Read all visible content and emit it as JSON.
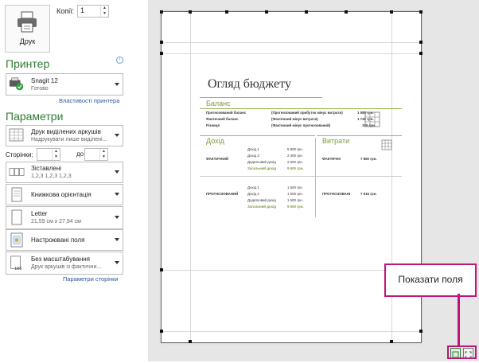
{
  "print": {
    "label": "Друк"
  },
  "copies": {
    "label": "Копії:",
    "value": "1"
  },
  "printer": {
    "section_title": "Принтер",
    "name": "Snagit 12",
    "status": "Готово",
    "properties_link": "Властивості принтера"
  },
  "parameters": {
    "section_title": "Параметри",
    "scope": {
      "title": "Друк виділених аркушів",
      "subtitle": "Надрукувати лише виділені..."
    },
    "pages": {
      "label": "Сторінки:",
      "to": "до"
    },
    "collate": {
      "title": "Зіставлені",
      "subtitle": "1,2,3    1,2,3    1,2,3"
    },
    "orientation": {
      "title": "Книжкова орієнтація"
    },
    "paper": {
      "title": "Letter",
      "subtitle": "21,59 см x 27,94 см"
    },
    "margins": {
      "title": "Настроювані поля"
    },
    "scaling": {
      "title": "Без масштабування",
      "subtitle": "Друк аркушів із фактични..."
    },
    "page_setup_link": "Параметри сторінки"
  },
  "preview": {
    "doc_title": "Огляд бюджету",
    "balance": {
      "heading": "Баланс",
      "rows": [
        {
          "label": "Прогнозований баланс",
          "desc": "(Прогнозований прибуток мінус витрати)",
          "value": "1 585 грн."
        },
        {
          "label": "Фактичний баланс",
          "desc": "(Фактичний мінус витрати)",
          "value": "1 740 грн."
        },
        {
          "label": "Різниця",
          "desc": "(Фактичний мінус прогнозований)",
          "value": "155 грн."
        }
      ]
    },
    "income": {
      "heading": "Дохід",
      "actual": {
        "label": "ФАКТИЧНИЙ",
        "lines": [
          {
            "name": "Дохід 1",
            "value": "5 800 грн."
          },
          {
            "name": "Дохід 2",
            "value": "2 300 грн."
          },
          {
            "name": "Додатковий дохід",
            "value": "2 500 грн."
          }
        ],
        "total_label": "Загальний дохід",
        "total_value": "9 600 грн."
      },
      "projected": {
        "label": "ПРОГНОЗОВАНИЙ",
        "lines": [
          {
            "name": "Дохід 1",
            "value": "1 500 грн."
          },
          {
            "name": "Дохід 2",
            "value": "1 500 грн."
          },
          {
            "name": "Додатковий дохід",
            "value": "1 500 грн."
          }
        ],
        "total_label": "Загальний дохід",
        "total_value": "9 500 грн."
      }
    },
    "expenses": {
      "heading": "Витрати",
      "actual": {
        "label": "ФАКТИЧНІ",
        "value": "7 860 грн."
      },
      "projected": {
        "label": "ПРОГНОЗОВАНІ",
        "value": "7 915 грн."
      }
    }
  },
  "callout": {
    "text": "Показати поля"
  },
  "colors": {
    "accent_green": "#2e7d32",
    "callout_magenta": "#c0157a",
    "doc_heading": "#7b9c3c"
  }
}
